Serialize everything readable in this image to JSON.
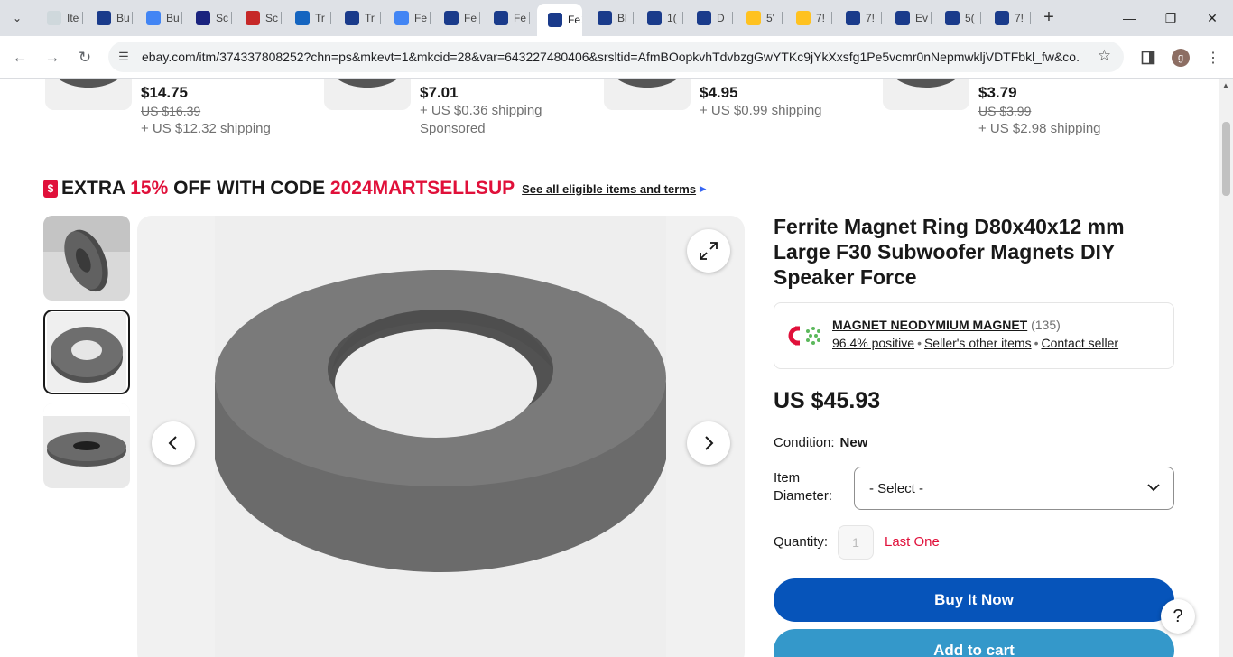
{
  "browser": {
    "tabs": [
      {
        "label": "Ite",
        "fav_color": "#cfd8dc"
      },
      {
        "label": "Bu",
        "fav_color": "#1a3b8b"
      },
      {
        "label": "Bu",
        "fav_color": "#4285f4"
      },
      {
        "label": "Sc",
        "fav_color": "#1a237e"
      },
      {
        "label": "Sc",
        "fav_color": "#c62828"
      },
      {
        "label": "Tr",
        "fav_color": "#1565c0"
      },
      {
        "label": "Tr",
        "fav_color": "#1a3b8b"
      },
      {
        "label": "Fe",
        "fav_color": "#4285f4"
      },
      {
        "label": "Fe",
        "fav_color": "#1a3b8b"
      },
      {
        "label": "Fe",
        "fav_color": "#1a3b8b"
      },
      {
        "label": "Fe",
        "fav_color": "#1a3b8b"
      },
      {
        "label": "Bl",
        "fav_color": "#1a3b8b"
      },
      {
        "label": "1(",
        "fav_color": "#1a3b8b"
      },
      {
        "label": "D",
        "fav_color": "#1a3b8b"
      },
      {
        "label": "5'",
        "fav_color": "#ffc220"
      },
      {
        "label": "7!",
        "fav_color": "#ffc220"
      },
      {
        "label": "7!",
        "fav_color": "#1a3b8b"
      },
      {
        "label": "Ev",
        "fav_color": "#1a3b8b"
      },
      {
        "label": "5(",
        "fav_color": "#1a3b8b"
      },
      {
        "label": "7!",
        "fav_color": "#1a3b8b"
      }
    ],
    "active_tab_index": 10,
    "url": "ebay.com/itm/374337808252?chn=ps&mkevt=1&mkcid=28&var=643227480406&srsltid=AfmBOopkvhTdvbzgGwYTKc9jYkXxsfg1Pe5vcmr0nNepmwkljVDTFbkl_fw&co...",
    "profile_initial": "g"
  },
  "recommendations": [
    {
      "price": "$14.75",
      "was": "US $16.39",
      "shipping": "+ US $12.32 shipping",
      "sponsored": ""
    },
    {
      "price": "$7.01",
      "was": "",
      "shipping": "+ US $0.36 shipping",
      "sponsored": "Sponsored"
    },
    {
      "price": "$4.95",
      "was": "",
      "shipping": "+ US $0.99 shipping",
      "sponsored": ""
    },
    {
      "price": "$3.79",
      "was": "US $3.99",
      "shipping": "+ US $2.98 shipping",
      "sponsored": ""
    }
  ],
  "promo": {
    "icon_text": "$",
    "prefix": "EXTRA ",
    "percent": "15%",
    "middle": " OFF WITH CODE ",
    "code": "2024MARTSELLSUP",
    "terms": "See all eligible items and terms"
  },
  "product": {
    "title": "Ferrite Magnet Ring D80x40x12 mm Large F30 Subwoofer Magnets DIY Speaker Force",
    "seller_name": "MAGNET NEODYMIUM MAGNET",
    "seller_count": "(135)",
    "feedback": "96.4% positive",
    "other_items": "Seller's other items",
    "contact": "Contact seller",
    "price": "US $45.93",
    "condition_label": "Condition:",
    "condition_value": "New",
    "variation_label": "Item Diameter:",
    "variation_value": "- Select -",
    "quantity_label": "Quantity:",
    "quantity_value": "1",
    "stock_note": "Last One",
    "buy_now": "Buy It Now",
    "add_to_cart": "Add to cart"
  },
  "help_label": "?"
}
